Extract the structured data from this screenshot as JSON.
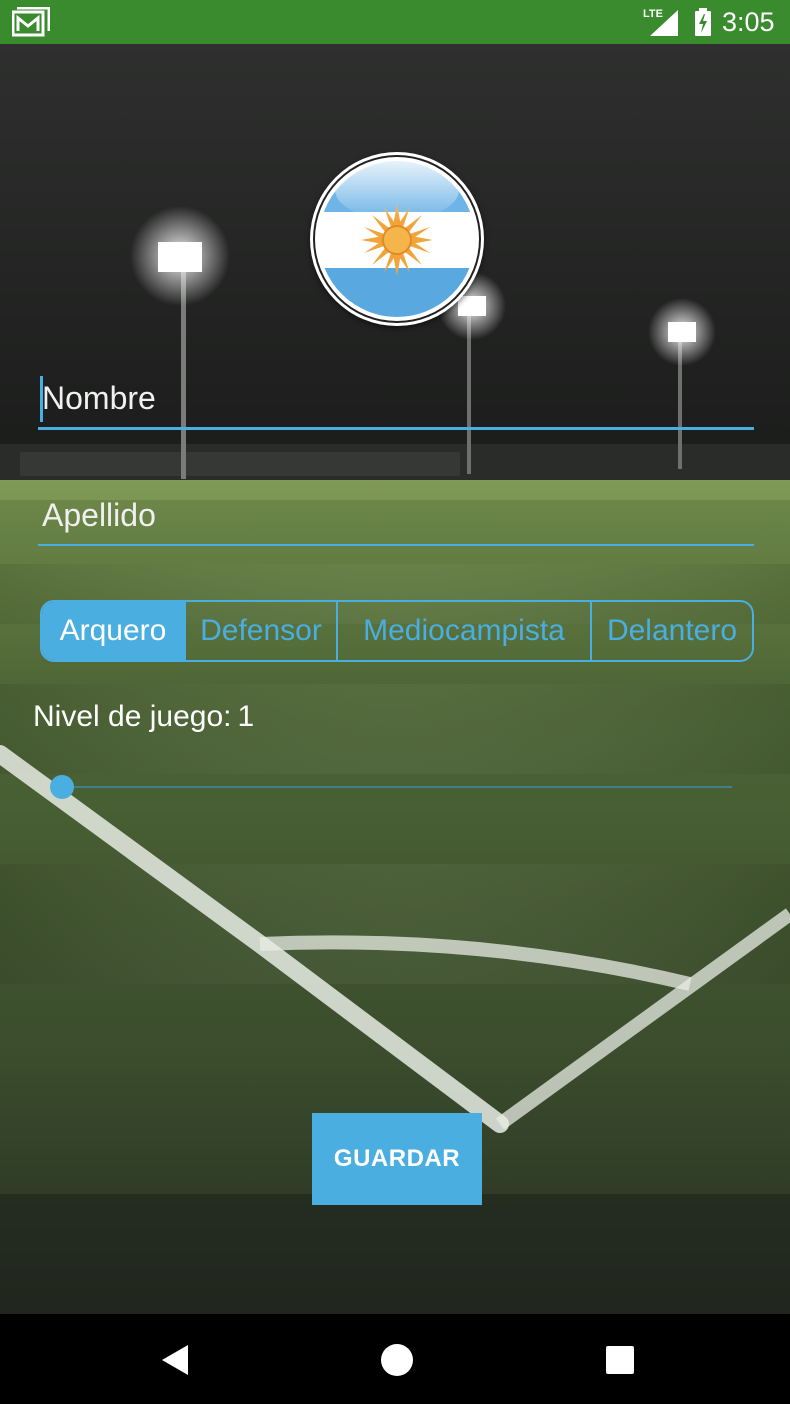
{
  "status_bar": {
    "time": "3:05",
    "network": "LTE",
    "notification_icon": "gmail-icon",
    "colors": {
      "background": "#3a8a2e"
    }
  },
  "profile": {
    "flag_icon": "argentina-flag-icon"
  },
  "form": {
    "nombre_placeholder": "Nombre",
    "apellido_placeholder": "Apellido",
    "positions": [
      {
        "label": "Arquero",
        "selected": true
      },
      {
        "label": "Defensor",
        "selected": false
      },
      {
        "label": "Mediocampista",
        "selected": false
      },
      {
        "label": "Delantero",
        "selected": false
      }
    ],
    "level_label": "Nivel de juego:",
    "level_value": "1",
    "level_fraction": 0,
    "save_label": "GUARDAR"
  },
  "nav_bar": {
    "back_icon": "back-icon",
    "home_icon": "home-icon",
    "recents_icon": "recents-icon"
  },
  "theme": {
    "accent": "#4aaee0",
    "text": "#ffffff"
  }
}
